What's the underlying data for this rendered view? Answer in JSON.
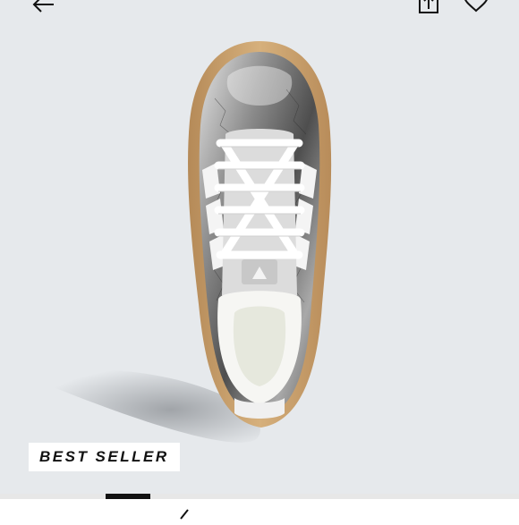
{
  "badge": {
    "label": "BEST SELLER"
  },
  "icons": {
    "back": "arrow-left-icon",
    "share": "share-icon",
    "wishlist": "heart-icon",
    "carousel_prev": "chevron-left-icon"
  },
  "product": {
    "brand_mark": "adidas"
  },
  "colors": {
    "background": "#e6e9ec",
    "badge_bg": "#ffffff",
    "badge_text": "#111111",
    "pager_active": "#111111",
    "pager_track": "#e7e7e7"
  }
}
